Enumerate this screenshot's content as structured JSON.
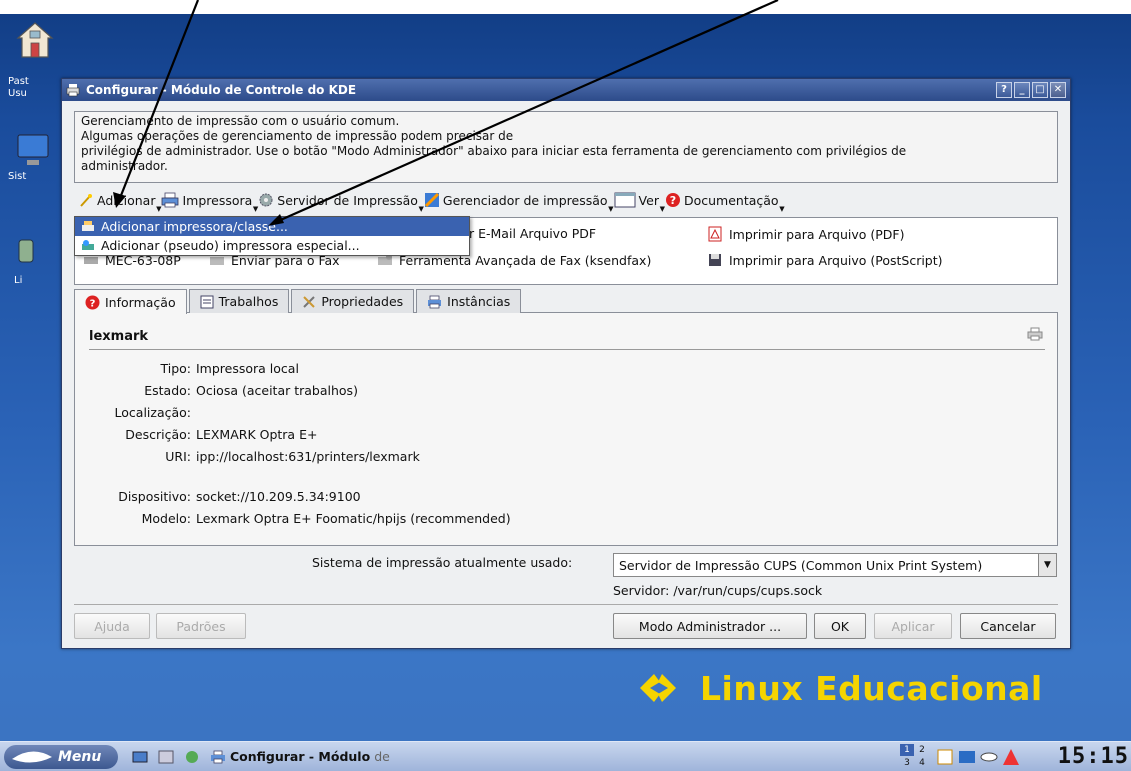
{
  "desktop": {
    "icons": [
      {
        "label": "Past"
      },
      {
        "label": "Usu"
      },
      {
        "label": "Sist"
      },
      {
        "label": "Li"
      }
    ],
    "brand_text": "Linux Educacional"
  },
  "window": {
    "title": "Configurar - Módulo de Controle do KDE",
    "buttons": [
      "?",
      "_",
      "□",
      "✕"
    ]
  },
  "info": {
    "lines": [
      "Gerenciamento de impressão com o usuário comum.",
      "Algumas operações de gerenciamento de impressão podem precisar de",
      " privilégios de administrador. Use o botão \"Modo Administrador\" abaixo para iniciar esta ferramenta de gerenciamento com privilégios de",
      "administrador."
    ]
  },
  "toolbar": {
    "adicionar": "Adicionar",
    "impressora": "Impressora",
    "servidor": "Servidor de Impressão",
    "gerenciador": "Gerenciador de impressão",
    "ver": "Ver",
    "documentacao": "Documentação"
  },
  "dropdown": {
    "item1": "Adicionar impressora/classe...",
    "item2": "Adicionar (pseudo) impressora especial..."
  },
  "printers": {
    "r1c2": "r E-Mail Arquivo PDF",
    "r1c3": "Imprimir para Arquivo (PDF)",
    "r2c1": "MEC-63-08P",
    "r2c2": "Enviar para o Fax",
    "r2c3": "Ferramenta Avançada de Fax (ksendfax)",
    "r2c4": "Imprimir para Arquivo (PostScript)"
  },
  "tabs": {
    "info": "Informação",
    "trabalhos": "Trabalhos",
    "propriedades": "Propriedades",
    "instancias": "Instâncias"
  },
  "details": {
    "name": "lexmark",
    "tipo_k": "Tipo:",
    "tipo_v": "Impressora local",
    "estado_k": "Estado:",
    "estado_v": "Ociosa (aceitar trabalhos)",
    "local_k": "Localização:",
    "local_v": "",
    "desc_k": "Descrição:",
    "desc_v": "LEXMARK Optra E+",
    "uri_k": "URI:",
    "uri_v": "ipp://localhost:631/printers/lexmark",
    "disp_k": "Dispositivo:",
    "disp_v": "socket://10.209.5.34:9100",
    "modelo_k": "Modelo:",
    "modelo_v": "Lexmark Optra E+ Foomatic/hpijs (recommended)"
  },
  "system": {
    "label": "Sistema de impressão atualmente usado:",
    "value": "Servidor de Impressão CUPS (Common Unix Print System)",
    "servidor": "Servidor: /var/run/cups/cups.sock"
  },
  "buttons": {
    "ajuda": "Ajuda",
    "padroes": "Padrões",
    "modo_admin": "Modo Administrador ...",
    "ok": "OK",
    "aplicar": "Aplicar",
    "cancelar": "Cancelar"
  },
  "taskbar": {
    "menu": "Menu",
    "task_title": "Configurar - Módulo",
    "task_title_faded": "de",
    "pager": [
      "1",
      "2",
      "3",
      "4"
    ],
    "clock": "15:15"
  },
  "colors": {
    "accent": "#3a62b0",
    "brand": "#f5d400",
    "titlebar": "#2d4b8a"
  }
}
